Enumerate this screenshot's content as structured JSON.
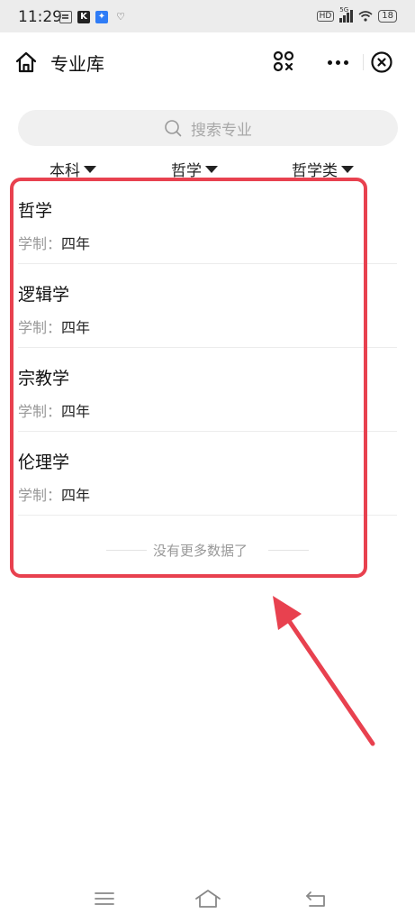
{
  "status_bar": {
    "time": "11:29",
    "app_icons": [
      "message-icon",
      "k-app-icon",
      "a-app-icon",
      "heart-app-icon"
    ],
    "hd_label": "HD",
    "network_label": "5G",
    "battery": "18"
  },
  "navbar": {
    "title": "专业库"
  },
  "search": {
    "placeholder": "搜索专业"
  },
  "filters": [
    {
      "label": "本科"
    },
    {
      "label": "哲学"
    },
    {
      "label": "哲学类"
    }
  ],
  "majors": [
    {
      "name": "哲学",
      "duration_label": "学制：",
      "duration_value": "四年"
    },
    {
      "name": "逻辑学",
      "duration_label": "学制：",
      "duration_value": "四年"
    },
    {
      "name": "宗教学",
      "duration_label": "学制：",
      "duration_value": "四年"
    },
    {
      "name": "伦理学",
      "duration_label": "学制：",
      "duration_value": "四年"
    }
  ],
  "list_footer": "没有更多数据了",
  "annotation": {
    "color": "#e8414f"
  }
}
